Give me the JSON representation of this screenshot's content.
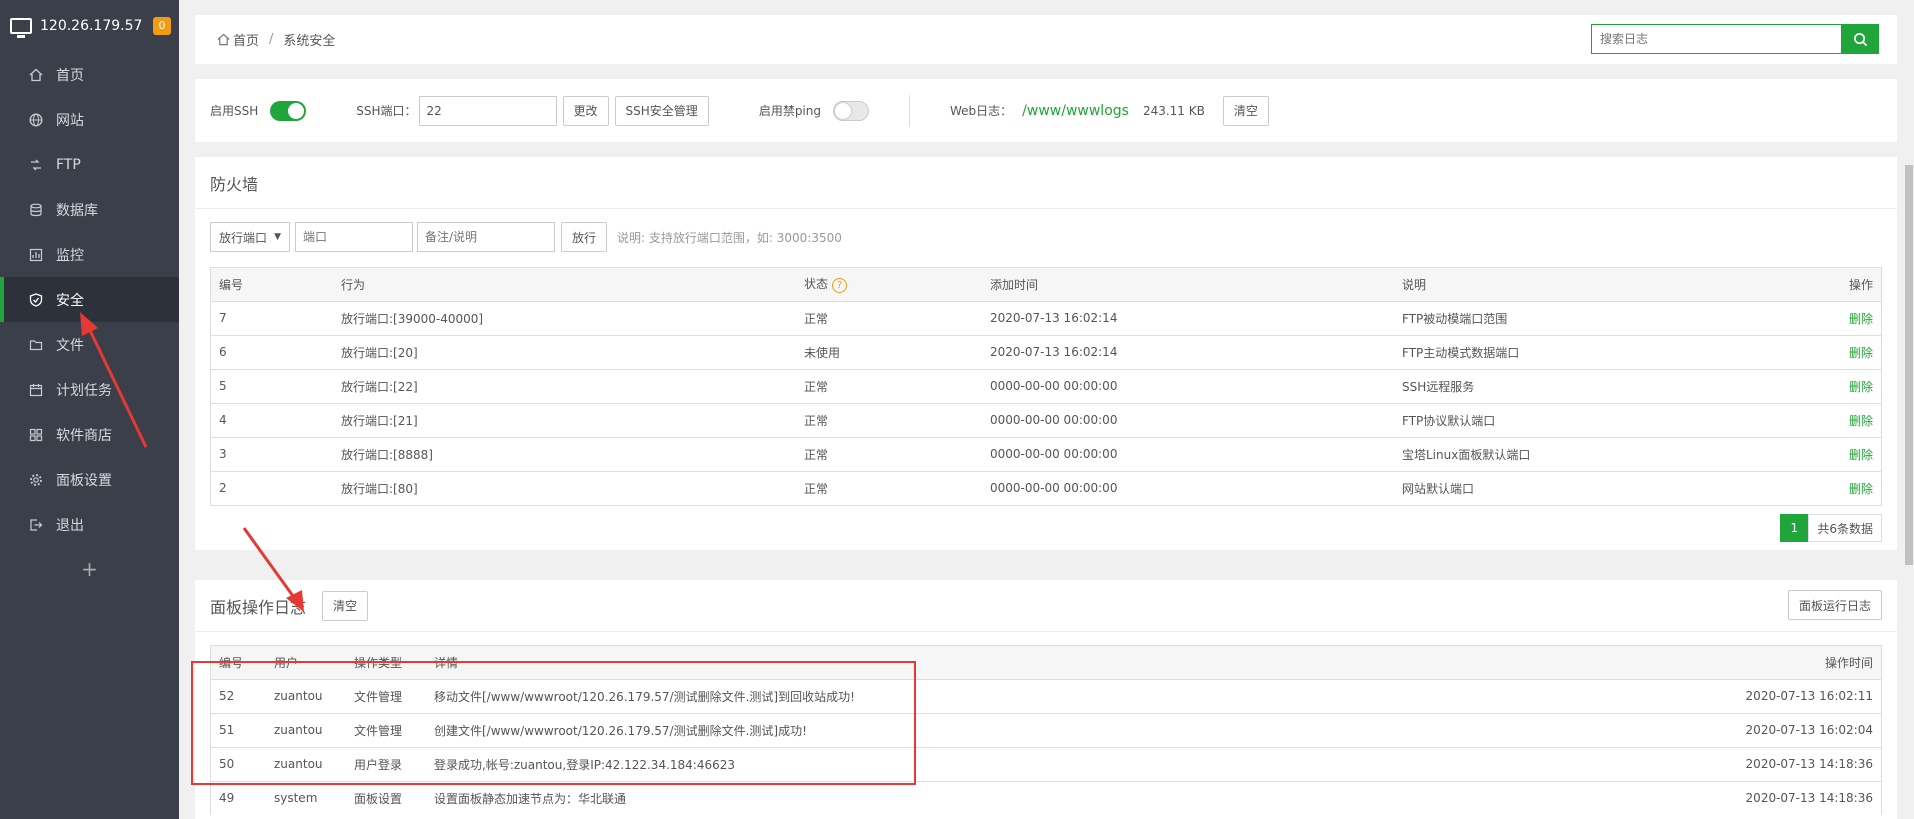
{
  "sidebar": {
    "server_ip": "120.26.179.57",
    "badge": "0",
    "items": [
      {
        "label": "首页",
        "icon": "home-icon"
      },
      {
        "label": "网站",
        "icon": "globe-icon"
      },
      {
        "label": "FTP",
        "icon": "ftp-icon"
      },
      {
        "label": "数据库",
        "icon": "database-icon"
      },
      {
        "label": "监控",
        "icon": "monitor-chart-icon"
      },
      {
        "label": "安全",
        "icon": "shield-icon"
      },
      {
        "label": "文件",
        "icon": "folder-icon"
      },
      {
        "label": "计划任务",
        "icon": "calendar-icon"
      },
      {
        "label": "软件商店",
        "icon": "apps-icon"
      },
      {
        "label": "面板设置",
        "icon": "gear-icon"
      },
      {
        "label": "退出",
        "icon": "logout-icon"
      }
    ],
    "active_index": 5,
    "add_label": "+"
  },
  "header": {
    "breadcrumb_home": "首页",
    "breadcrumb_sep": "/",
    "breadcrumb_current": "系统安全",
    "search_placeholder": "搜索日志"
  },
  "ssh": {
    "enable_ssh_label": "启用SSH",
    "enable_ssh_on": true,
    "port_label": "SSH端口：",
    "port_value": "22",
    "change_button": "更改",
    "manage_button": "SSH安全管理",
    "ping_label": "启用禁ping",
    "ping_on": false,
    "weblog_label": "Web日志：",
    "weblog_path": "/www/wwwlogs",
    "weblog_size": "243.11 KB",
    "clear_button": "清空"
  },
  "firewall": {
    "title": "防火墙",
    "select_value": "放行端口",
    "port_placeholder": "端口",
    "remark_placeholder": "备注/说明",
    "allow_button": "放行",
    "tip": "说明: 支持放行端口范围，如: 3000:3500",
    "columns": [
      "编号",
      "行为",
      "状态",
      "添加时间",
      "说明",
      "操作"
    ],
    "rows": [
      {
        "id": "7",
        "action": "放行端口:[39000-40000]",
        "status": "正常",
        "time": "2020-07-13 16:02:14",
        "desc": "FTP被动模端口范围",
        "op": "删除"
      },
      {
        "id": "6",
        "action": "放行端口:[20]",
        "status": "未使用",
        "time": "2020-07-13 16:02:14",
        "desc": "FTP主动模式数据端口",
        "op": "删除"
      },
      {
        "id": "5",
        "action": "放行端口:[22]",
        "status": "正常",
        "time": "0000-00-00 00:00:00",
        "desc": "SSH远程服务",
        "op": "删除"
      },
      {
        "id": "4",
        "action": "放行端口:[21]",
        "status": "正常",
        "time": "0000-00-00 00:00:00",
        "desc": "FTP协议默认端口",
        "op": "删除"
      },
      {
        "id": "3",
        "action": "放行端口:[8888]",
        "status": "正常",
        "time": "0000-00-00 00:00:00",
        "desc": "宝塔Linux面板默认端口",
        "op": "删除"
      },
      {
        "id": "2",
        "action": "放行端口:[80]",
        "status": "正常",
        "time": "0000-00-00 00:00:00",
        "desc": "网站默认端口",
        "op": "删除"
      }
    ],
    "page_current": "1",
    "page_total": "共6条数据"
  },
  "logs": {
    "title": "面板操作日志",
    "clear_button": "清空",
    "run_log_button": "面板运行日志",
    "columns": [
      "编号",
      "用户",
      "操作类型",
      "详情",
      "操作时间"
    ],
    "rows": [
      {
        "id": "52",
        "user": "zuantou",
        "type": "文件管理",
        "detail": "移动文件[/www/wwwroot/120.26.179.57/测试删除文件.测试]到回收站成功!",
        "time": "2020-07-13 16:02:11"
      },
      {
        "id": "51",
        "user": "zuantou",
        "type": "文件管理",
        "detail": "创建文件[/www/wwwroot/120.26.179.57/测试删除文件.测试]成功!",
        "time": "2020-07-13 16:02:04"
      },
      {
        "id": "50",
        "user": "zuantou",
        "type": "用户登录",
        "detail": "登录成功,帐号:zuantou,登录IP:42.122.34.184:46623",
        "time": "2020-07-13 14:18:36"
      },
      {
        "id": "49",
        "user": "system",
        "type": "面板设置",
        "detail": "设置面板静态加速节点为：华北联通",
        "time": "2020-07-13 14:18:36"
      }
    ]
  },
  "colors": {
    "accent": "#20a53a",
    "sidebar_bg": "#3a3f4a",
    "annotation_red": "#e53935"
  }
}
